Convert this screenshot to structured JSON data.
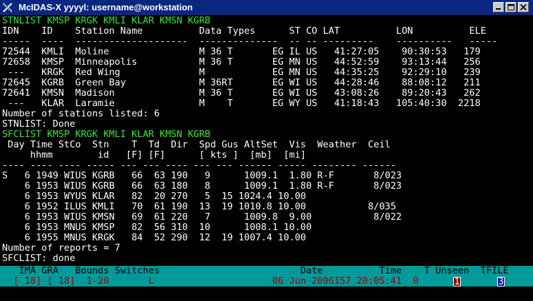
{
  "window": {
    "title": "McIDAS-X yyyyl: username@workstation",
    "buttons": [
      "minimize-icon",
      "maximize-icon",
      "close-icon"
    ]
  },
  "terminal_lines": [
    {
      "text": "STNLIST KMSP KRGK KMLI KLAR KMSN KGRB",
      "color": "green"
    },
    {
      "text": "IDN    ID    Station Name          Data Types      ST CO LAT          LON          ELE",
      "color": "white"
    },
    {
      "text": "-----  ----  --------------------  --------------  -- -- ---------    ----------   -----",
      "color": "white"
    },
    {
      "text": "72544  KMLI  Moline                M 36 T       EG IL US   41:27:05    90:30:53   179",
      "color": "white"
    },
    {
      "text": "72658  KMSP  Minneapolis           M 36 T       EG MN US   44:52:59    93:13:44   256",
      "color": "white"
    },
    {
      "text": " ---   KRGK  Red Wing              M            EG MN US   44:35:25    92:29:10   239",
      "color": "white"
    },
    {
      "text": "72645  KGRB  Green Bay             M 36RT       EG WI US   44:28:46    88:08:12   211",
      "color": "white"
    },
    {
      "text": "72641  KMSN  Madison               M 36 T       EG WI US   43:08:26    89:20:43   262",
      "color": "white"
    },
    {
      "text": " ---   KLAR  Laramie               M    T       EG WY US   41:18:43   105:40:30  2218",
      "color": "white"
    },
    {
      "text": "Number of stations listed: 6",
      "color": "white"
    },
    {
      "text": "STNLIST: Done",
      "color": "white"
    },
    {
      "text": "SFCLIST KMSP KRGK KMLI KLAR KMSN KGRB",
      "color": "green"
    },
    {
      "text": " Day Time StCo  Stn    T  Td  Dir  Spd Gus AltSet  Vis  Weather  Ceil",
      "color": "white"
    },
    {
      "text": "     hhmm        id   [F] [F]      [ kts ]  [mb]  [mi]",
      "color": "white"
    },
    {
      "text": "---- ---- ---- ----- --- --- ---- --- --- ------ ----- -------- ------",
      "color": "white"
    },
    {
      "text": "S   6 1949 WIUS KGRB   66  63 190   9      1009.1  1.80 R-F       8/023",
      "color": "white"
    },
    {
      "text": "    6 1953 WIUS KGRB   66  63 180   8      1009.1  1.80 R-F       8/023",
      "color": "white"
    },
    {
      "text": "    6 1953 WYUS KLAR   82  20 270   5  15 1024.4 10.00",
      "color": "white"
    },
    {
      "text": "    6 1952 ILUS KMLI   70  61 190  13  19 1010.8 10.00           8/035",
      "color": "white"
    },
    {
      "text": "    6 1953 WIUS KMSN   69  61 220   7      1009.8  9.00           8/022",
      "color": "white"
    },
    {
      "text": "    6 1953 MNUS KMSP   82  56 310  10      1008.1 10.00",
      "color": "white"
    },
    {
      "text": "    6 1955 MNUS KRGK   84  52 290  12  19 1007.4 10.00",
      "color": "white"
    },
    {
      "text": "Number of reports = 7",
      "color": "white"
    },
    {
      "text": "SFCLIST: done",
      "color": "white"
    }
  ],
  "status_bar": {
    "header": "   IMA GRA   Bounds Switches                         Date          Time    T Unseen  TFILE",
    "values": "  [ 18] [ 18]  1-20       L                     06 Jun 2006157 20:05:41  0",
    "unseen": "1",
    "tfile": "3"
  },
  "colors": {
    "titlebar": "#0a2780",
    "terminal_bg": "#000000",
    "command_text": "#2dec2d",
    "status_bg": "#009a9a",
    "status_values": "#a80000"
  }
}
